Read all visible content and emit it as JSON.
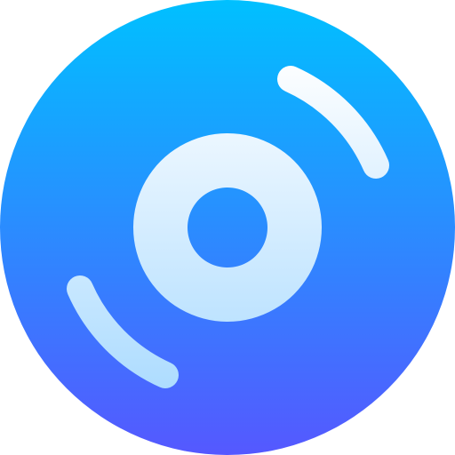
{
  "icon": {
    "name": "disc-icon",
    "colors": {
      "gradient_top": "#00c0ff",
      "gradient_bottom": "#5558ff",
      "light_top": "#ffffff",
      "light_bottom": "#addcff"
    }
  }
}
